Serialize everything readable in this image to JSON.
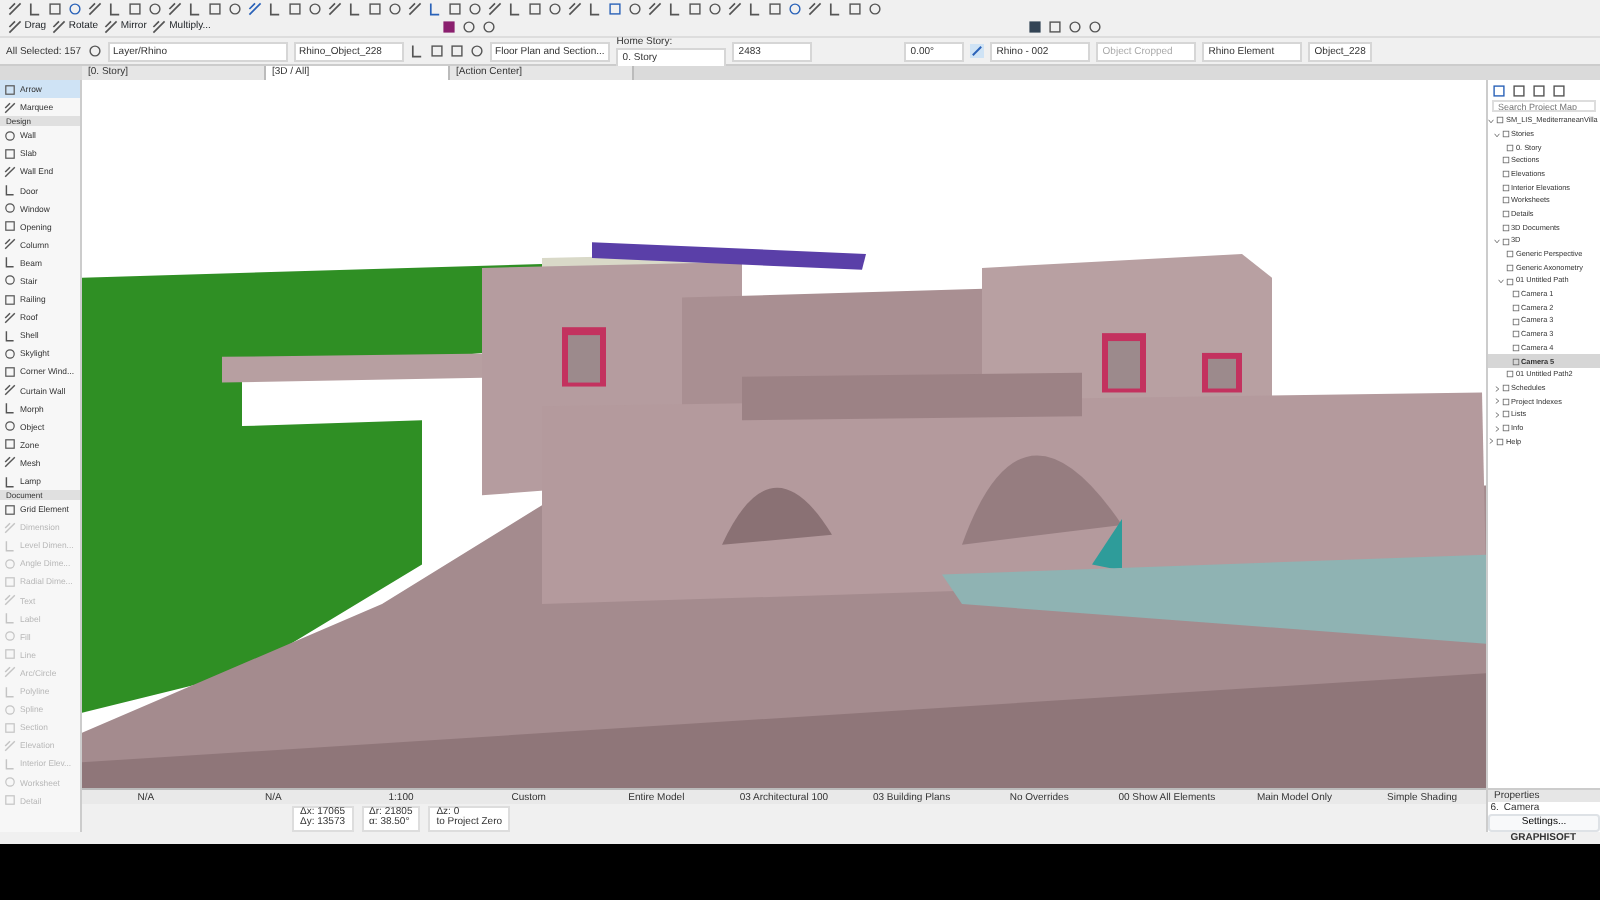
{
  "toolbar": {
    "edit_tools": [
      "Drag",
      "Rotate",
      "Mirror",
      "Multiply..."
    ]
  },
  "info_box": {
    "selection": "All Selected: 157",
    "layer": "Layer/Rhino",
    "object_name": "Rhino_Object_228",
    "view": "Floor Plan and Section...",
    "home_story_label": "Home Story:",
    "home_story": "0. Story",
    "elevation": "2483",
    "angle": "0.00°",
    "pen": "Rhino - 002",
    "cropped": "Object Cropped",
    "classification": "Rhino Element",
    "element_id": "Object_228"
  },
  "tabs": [
    {
      "label": "[0. Story]",
      "selected": false
    },
    {
      "label": "[3D / All]",
      "selected": true
    },
    {
      "label": "[Action Center]",
      "selected": false
    }
  ],
  "toolbox": [
    {
      "kind": "tool",
      "label": "Arrow",
      "selected": true,
      "disabled": false
    },
    {
      "kind": "tool",
      "label": "Marquee",
      "selected": false,
      "disabled": false
    },
    {
      "kind": "header",
      "label": "Design"
    },
    {
      "kind": "tool",
      "label": "Wall",
      "selected": false,
      "disabled": false
    },
    {
      "kind": "tool",
      "label": "Slab",
      "selected": false,
      "disabled": false
    },
    {
      "kind": "tool",
      "label": "Wall End",
      "selected": false,
      "disabled": false
    },
    {
      "kind": "tool",
      "label": "Door",
      "selected": false,
      "disabled": false
    },
    {
      "kind": "tool",
      "label": "Window",
      "selected": false,
      "disabled": false
    },
    {
      "kind": "tool",
      "label": "Opening",
      "selected": false,
      "disabled": false
    },
    {
      "kind": "tool",
      "label": "Column",
      "selected": false,
      "disabled": false
    },
    {
      "kind": "tool",
      "label": "Beam",
      "selected": false,
      "disabled": false
    },
    {
      "kind": "tool",
      "label": "Stair",
      "selected": false,
      "disabled": false
    },
    {
      "kind": "tool",
      "label": "Railing",
      "selected": false,
      "disabled": false
    },
    {
      "kind": "tool",
      "label": "Roof",
      "selected": false,
      "disabled": false
    },
    {
      "kind": "tool",
      "label": "Shell",
      "selected": false,
      "disabled": false
    },
    {
      "kind": "tool",
      "label": "Skylight",
      "selected": false,
      "disabled": false
    },
    {
      "kind": "tool",
      "label": "Corner Wind...",
      "selected": false,
      "disabled": false
    },
    {
      "kind": "tool",
      "label": "Curtain Wall",
      "selected": false,
      "disabled": false
    },
    {
      "kind": "tool",
      "label": "Morph",
      "selected": false,
      "disabled": false
    },
    {
      "kind": "tool",
      "label": "Object",
      "selected": false,
      "disabled": false
    },
    {
      "kind": "tool",
      "label": "Zone",
      "selected": false,
      "disabled": false
    },
    {
      "kind": "tool",
      "label": "Mesh",
      "selected": false,
      "disabled": false
    },
    {
      "kind": "tool",
      "label": "Lamp",
      "selected": false,
      "disabled": false
    },
    {
      "kind": "header",
      "label": "Document"
    },
    {
      "kind": "tool",
      "label": "Grid Element",
      "selected": false,
      "disabled": false
    },
    {
      "kind": "tool",
      "label": "Dimension",
      "selected": false,
      "disabled": true
    },
    {
      "kind": "tool",
      "label": "Level Dimen...",
      "selected": false,
      "disabled": true
    },
    {
      "kind": "tool",
      "label": "Angle Dime...",
      "selected": false,
      "disabled": true
    },
    {
      "kind": "tool",
      "label": "Radial Dime...",
      "selected": false,
      "disabled": true
    },
    {
      "kind": "tool",
      "label": "Text",
      "selected": false,
      "disabled": true
    },
    {
      "kind": "tool",
      "label": "Label",
      "selected": false,
      "disabled": true
    },
    {
      "kind": "tool",
      "label": "Fill",
      "selected": false,
      "disabled": true
    },
    {
      "kind": "tool",
      "label": "Line",
      "selected": false,
      "disabled": true
    },
    {
      "kind": "tool",
      "label": "Arc/Circle",
      "selected": false,
      "disabled": true
    },
    {
      "kind": "tool",
      "label": "Polyline",
      "selected": false,
      "disabled": true
    },
    {
      "kind": "tool",
      "label": "Spline",
      "selected": false,
      "disabled": true
    },
    {
      "kind": "tool",
      "label": "Section",
      "selected": false,
      "disabled": true
    },
    {
      "kind": "tool",
      "label": "Elevation",
      "selected": false,
      "disabled": true
    },
    {
      "kind": "tool",
      "label": "Interior Elev...",
      "selected": false,
      "disabled": true
    },
    {
      "kind": "tool",
      "label": "Worksheet",
      "selected": false,
      "disabled": true
    },
    {
      "kind": "tool",
      "label": "Detail",
      "selected": false,
      "disabled": true
    }
  ],
  "navigator": {
    "search": {
      "placeholder": "Search Project Map"
    },
    "tree": [
      {
        "label": "SM_LIS_MediterraneanVilla",
        "selected": false,
        "expanded": true,
        "children": [
          {
            "label": "Stories",
            "selected": false,
            "expanded": true,
            "children": [
              {
                "label": "0. Story",
                "selected": false
              }
            ]
          },
          {
            "label": "Sections",
            "selected": false
          },
          {
            "label": "Elevations",
            "selected": false
          },
          {
            "label": "Interior Elevations",
            "selected": false
          },
          {
            "label": "Worksheets",
            "selected": false
          },
          {
            "label": "Details",
            "selected": false
          },
          {
            "label": "3D Documents",
            "selected": false
          },
          {
            "label": "3D",
            "selected": false,
            "expanded": true,
            "children": [
              {
                "label": "Generic Perspective",
                "selected": false
              },
              {
                "label": "Generic Axonometry",
                "selected": false
              },
              {
                "label": "01 Untitled Path",
                "selected": false,
                "expanded": true,
                "children": [
                  {
                    "label": "Camera 1",
                    "selected": false
                  },
                  {
                    "label": "Camera 2",
                    "selected": false
                  },
                  {
                    "label": "Camera 3",
                    "selected": false
                  },
                  {
                    "label": "Camera 3",
                    "selected": false
                  },
                  {
                    "label": "Camera 4",
                    "selected": false
                  },
                  {
                    "label": "Camera 5",
                    "selected": true
                  }
                ]
              },
              {
                "label": "01 Untitled Path2",
                "selected": false
              }
            ]
          },
          {
            "label": "Schedules",
            "selected": false,
            "expanded": false
          },
          {
            "label": "Project Indexes",
            "selected": false,
            "expanded": false
          },
          {
            "label": "Lists",
            "selected": false,
            "expanded": false
          },
          {
            "label": "Info",
            "selected": false,
            "expanded": false
          }
        ]
      },
      {
        "label": "Help",
        "selected": false,
        "expanded": false
      }
    ]
  },
  "properties": {
    "title": "Properties",
    "number": "6.",
    "type": "Camera",
    "settings": "Settings..."
  },
  "status_bar": [
    "N/A",
    "N/A",
    "1:100",
    "Custom",
    "Entire Model",
    "03 Architectural 100",
    "03 Building Plans",
    "No Overrides",
    "00 Show All Elements",
    "Main Model Only",
    "Simple Shading"
  ],
  "coordinates": {
    "dx": "Δx: 17065",
    "dy": "Δy: 13573",
    "dr": "Δr: 21805",
    "angle": "α: 38.50°",
    "dz": "Δz: 0",
    "reference": "to Project Zero"
  },
  "brand": "GRAPHISOFT"
}
